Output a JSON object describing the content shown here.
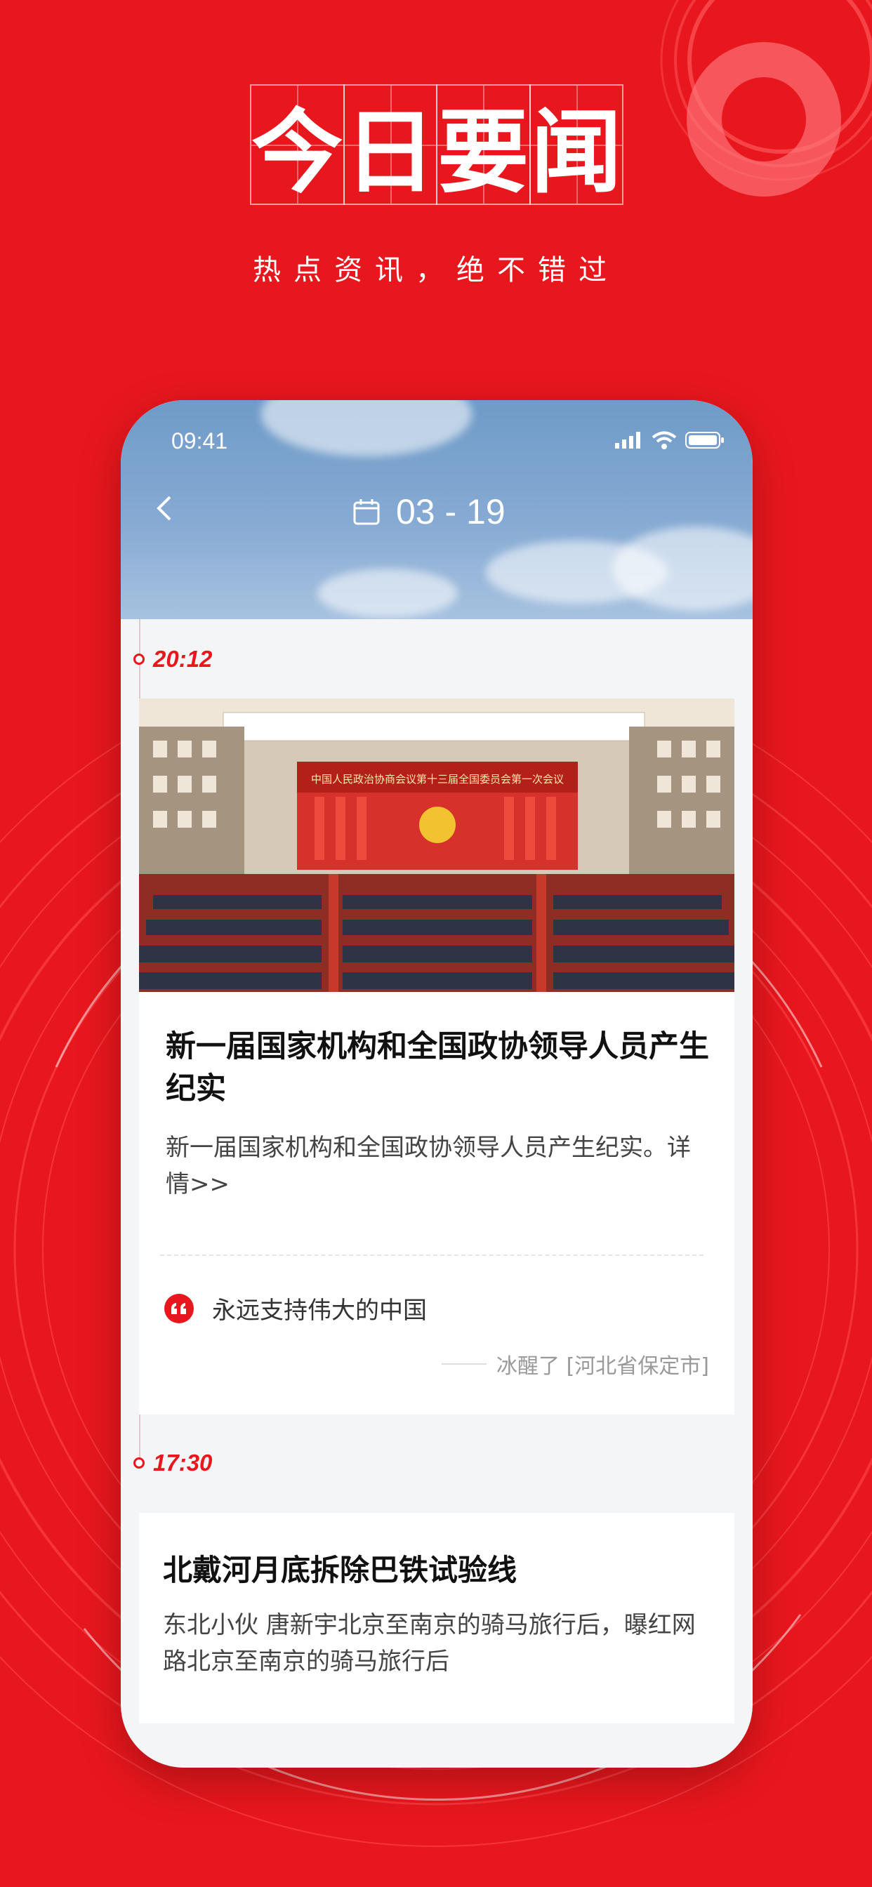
{
  "promo": {
    "headline_chars": [
      "今",
      "日",
      "要",
      "闻"
    ],
    "slogan": "热点资讯，绝不错过"
  },
  "phone": {
    "status_bar": {
      "time": "09:41"
    },
    "header": {
      "date": "03 - 19"
    }
  },
  "timeline": [
    {
      "time": "20:12",
      "title": "新一届国家机构和全国政协领导人员产生纪实",
      "summary": "新一届国家机构和全国政协领导人员产生纪实。详情>>",
      "image_caption": "中国人民政治协商会议第十三届全国委员会第一次会议",
      "comment": {
        "text": "永远支持伟大的中国",
        "author": "冰醒了 [河北省保定市]"
      }
    },
    {
      "time": "17:30",
      "title": "北戴河月底拆除巴铁试验线",
      "summary": "东北小伙 唐新宇北京至南京的骑马旅行后，曝红网路北京至南京的骑马旅行后"
    }
  ],
  "colors": {
    "brand_red": "#e8171d",
    "sky_blue": "#86aad3"
  }
}
